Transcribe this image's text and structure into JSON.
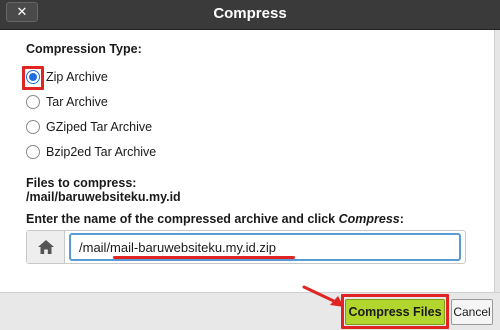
{
  "dialog": {
    "title": "Compress",
    "close_label": "✕"
  },
  "compression": {
    "label": "Compression Type:",
    "options": [
      {
        "label": "Zip Archive",
        "selected": true
      },
      {
        "label": "Tar Archive",
        "selected": false
      },
      {
        "label": "GZiped Tar Archive",
        "selected": false
      },
      {
        "label": "Bzip2ed Tar Archive",
        "selected": false
      }
    ]
  },
  "files": {
    "label": "Files to compress:",
    "path": "/mail/baruwebsiteku.my.id"
  },
  "archive_name": {
    "label_prefix": "Enter the name of the compressed archive and click ",
    "label_emphasis": "Compress",
    "label_suffix": ":",
    "value": "/mail/mail-baruwebsiteku.my.id.zip",
    "icon": "home-icon"
  },
  "buttons": {
    "compress_label": "Compress Files",
    "cancel_label": "Cancel"
  },
  "colors": {
    "titlebar": "#3a3a3a",
    "accent_highlight": "#e02424",
    "compress_button": "#b3d62e",
    "radio_selected": "#1f6fe0"
  }
}
